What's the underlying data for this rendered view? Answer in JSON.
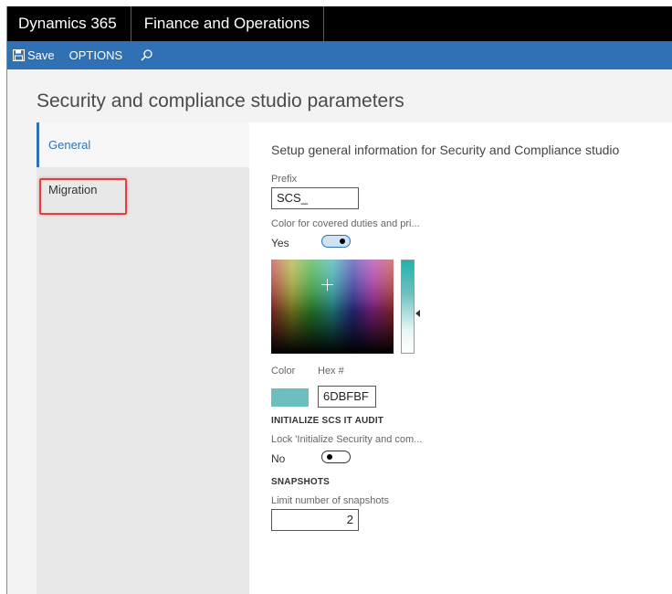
{
  "topbar": {
    "app_name": "Dynamics 365",
    "module_name": "Finance and Operations"
  },
  "actionbar": {
    "save_label": "Save",
    "options_label": "OPTIONS",
    "search_icon": "search-icon"
  },
  "page": {
    "title": "Security and compliance studio parameters"
  },
  "nav": {
    "items": [
      {
        "label": "General",
        "active": true
      },
      {
        "label": "Migration",
        "active": false
      }
    ]
  },
  "general": {
    "heading": "Setup general information for Security and Compliance studio",
    "prefix_label": "Prefix",
    "prefix_value": "SCS_",
    "color_covered_label": "Color for covered duties and pri...",
    "color_covered_value": "Yes",
    "color_label": "Color",
    "hex_label": "Hex #",
    "hex_value": "6DBFBF",
    "swatch_color": "#6DBFBF",
    "init_audit_header": "INITIALIZE SCS IT AUDIT",
    "lock_label": "Lock 'Initialize Security and com...",
    "lock_value": "No",
    "snapshots_header": "SNAPSHOTS",
    "limit_label": "Limit number of snapshots",
    "limit_value": "2"
  },
  "colors": {
    "accent": "#2F71B4",
    "topbar": "#000000",
    "highlight": "#E04040"
  }
}
